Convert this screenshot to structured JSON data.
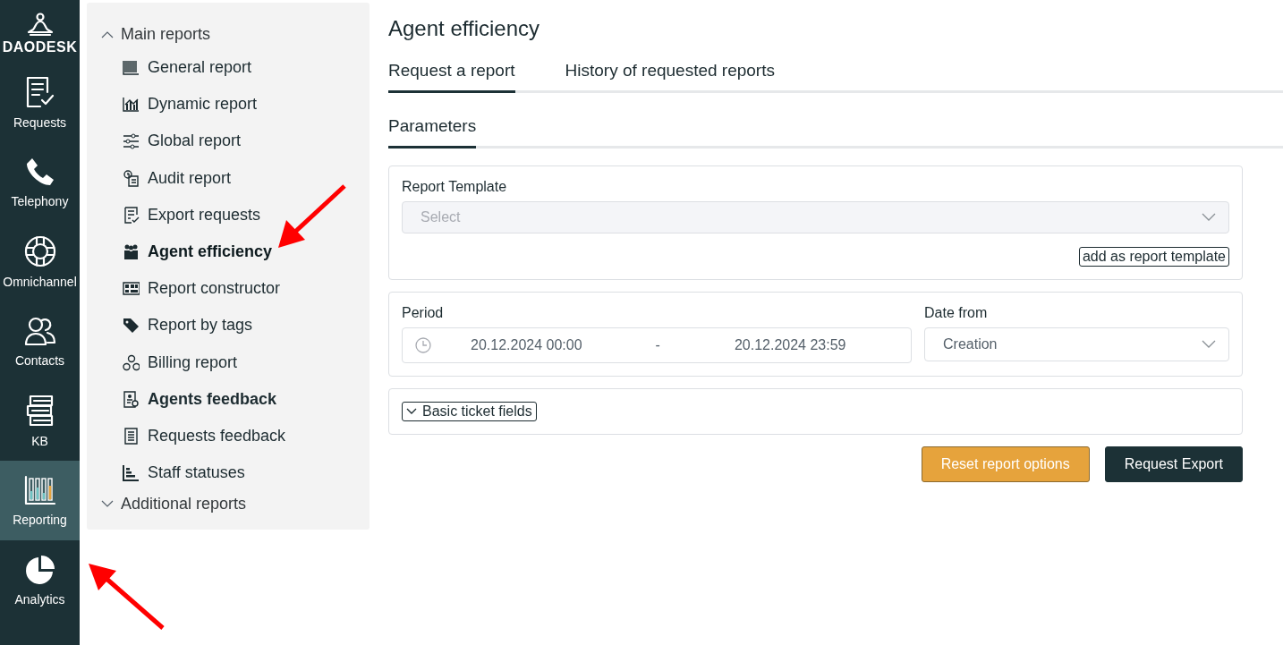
{
  "app": {
    "logo": "DAODESK"
  },
  "nav": [
    {
      "label": "Requests",
      "selected": false
    },
    {
      "label": "Telephony",
      "selected": false
    },
    {
      "label": "Omnichannel",
      "selected": false
    },
    {
      "label": "Contacts",
      "selected": false
    },
    {
      "label": "KB",
      "selected": false
    },
    {
      "label": "Reporting",
      "selected": true
    },
    {
      "label": "Analytics",
      "selected": false
    }
  ],
  "report_menu": [
    {
      "label": "Main reports",
      "expanded": true,
      "children": [
        {
          "label": "General report",
          "selected": false,
          "bold": false
        },
        {
          "label": "Dynamic report",
          "selected": false,
          "bold": false
        },
        {
          "label": "Global report",
          "selected": false,
          "bold": false
        },
        {
          "label": "Audit report",
          "selected": false,
          "bold": false
        },
        {
          "label": "Export requests",
          "selected": false,
          "bold": false
        },
        {
          "label": "Agent efficiency",
          "selected": true,
          "bold": true
        },
        {
          "label": "Report constructor",
          "selected": false,
          "bold": false
        },
        {
          "label": "Report by tags",
          "selected": false,
          "bold": false
        },
        {
          "label": "Billing report",
          "selected": false,
          "bold": false
        },
        {
          "label": "Agents feedback",
          "selected": false,
          "bold": true
        },
        {
          "label": "Requests feedback",
          "selected": false,
          "bold": false
        },
        {
          "label": "Staff statuses",
          "selected": false,
          "bold": false
        }
      ]
    },
    {
      "label": "Additional reports",
      "expanded": false
    }
  ],
  "page": {
    "title": "Agent efficiency",
    "tabs": [
      {
        "label": "Request a report",
        "selected": true
      },
      {
        "label": "History of requested reports",
        "selected": false
      }
    ],
    "subtabs": [
      {
        "label": "Parameters",
        "selected": true
      }
    ],
    "template": {
      "label": "Report Template",
      "placeholder": "Select",
      "disabled": true,
      "add_button": "add as report template"
    },
    "period": {
      "label": "Period",
      "from": "20.12.2024 00:00",
      "separator": "-",
      "to": "20.12.2024 23:59"
    },
    "date_from": {
      "label": "Date from",
      "value": "Creation"
    },
    "basic_fields": {
      "label": "Basic ticket fields",
      "expanded": false
    },
    "buttons": [
      {
        "label": "Reset report options",
        "kind": "secondary"
      },
      {
        "label": "Request Export",
        "kind": "primary"
      }
    ]
  }
}
